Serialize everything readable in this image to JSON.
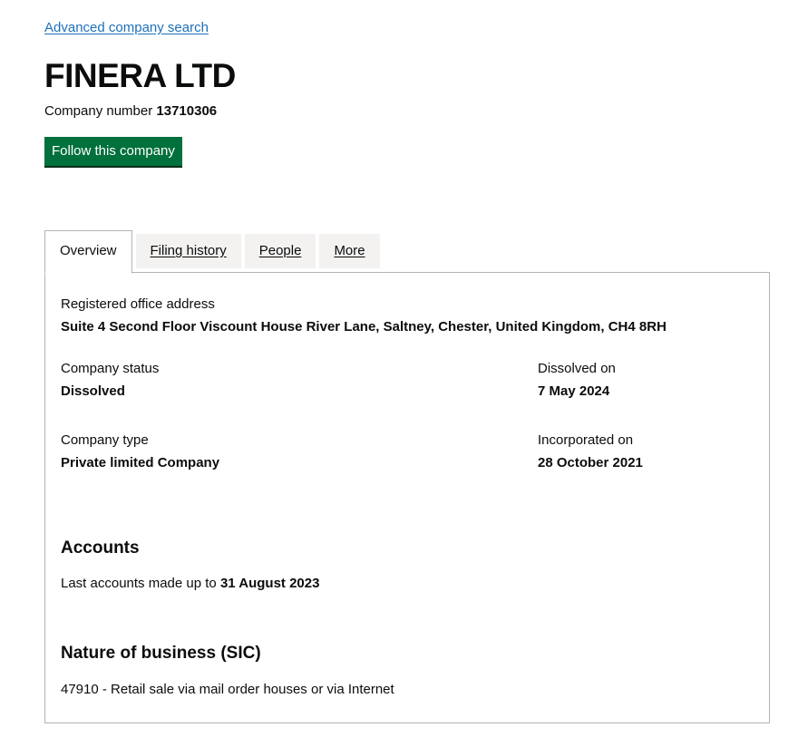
{
  "navigation": {
    "back_link": "Advanced company search"
  },
  "company": {
    "name": "FINERA LTD",
    "number_label": "Company number",
    "number": "13710306",
    "follow_button": "Follow this company"
  },
  "tabs": [
    {
      "label": "Overview",
      "active": true
    },
    {
      "label": "Filing history",
      "active": false
    },
    {
      "label": "People",
      "active": false
    },
    {
      "label": "More",
      "active": false
    }
  ],
  "overview": {
    "registered_office": {
      "label": "Registered office address",
      "value": "Suite 4 Second Floor Viscount House River Lane, Saltney, Chester, United Kingdom, CH4 8RH"
    },
    "status": {
      "label": "Company status",
      "value": "Dissolved"
    },
    "dissolved_on": {
      "label": "Dissolved on",
      "value": "7 May 2024"
    },
    "type": {
      "label": "Company type",
      "value": "Private limited Company"
    },
    "incorporated_on": {
      "label": "Incorporated on",
      "value": "28 October 2021"
    },
    "accounts": {
      "heading": "Accounts",
      "text": "Last accounts made up to",
      "date": "31 August 2023"
    },
    "sic": {
      "heading": "Nature of business (SIC)",
      "text": "47910 - Retail sale via mail order houses or via Internet"
    }
  },
  "colors": {
    "link": "#1d70b8",
    "button": "#00703c",
    "tab_inactive_bg": "#f3f2f1",
    "border": "#b1b4b6"
  }
}
